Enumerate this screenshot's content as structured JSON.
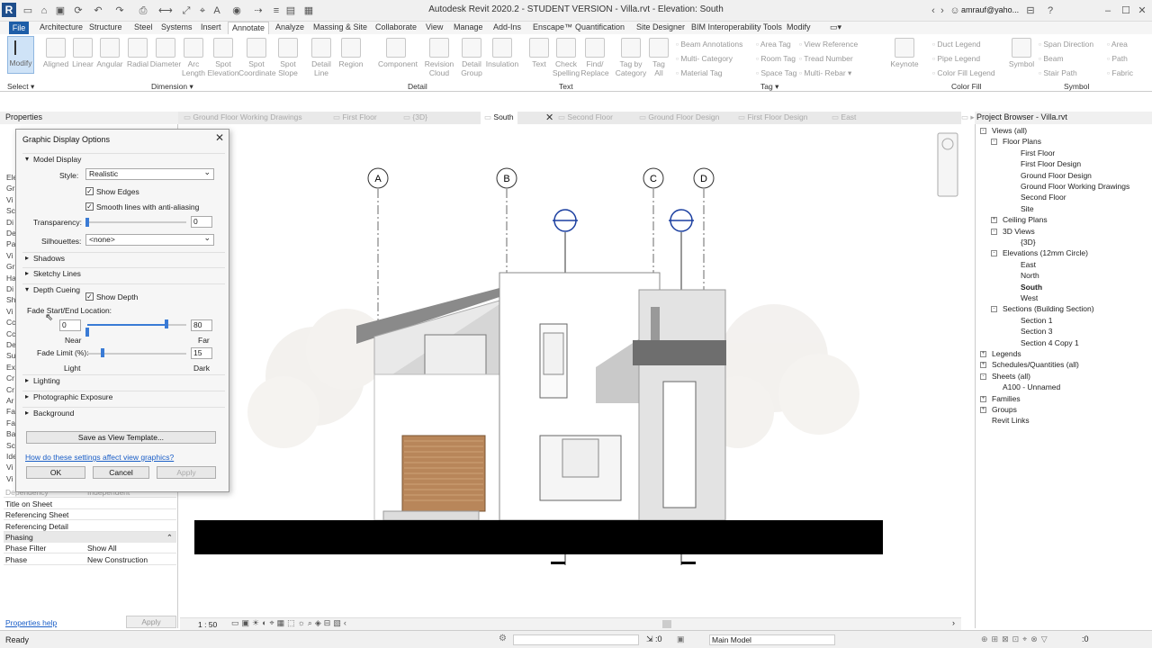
{
  "app": {
    "title": "Autodesk Revit 2020.2 - STUDENT VERSION - Villa.rvt - Elevation: South",
    "user": "amrauf@yaho...",
    "logo": "R"
  },
  "ribbon_tabs": [
    "Architecture",
    "Structure",
    "Steel",
    "Systems",
    "Insert",
    "Annotate",
    "Analyze",
    "Massing & Site",
    "Collaborate",
    "View",
    "Manage",
    "Add-Ins",
    "Enscape™",
    "Quantification",
    "Site Designer",
    "BIM Interoperability Tools",
    "Modify"
  ],
  "file_tab": "File",
  "ribbon": {
    "select": {
      "modify": "Modify",
      "group": "Select ▾"
    },
    "dimension": {
      "tools": [
        "Aligned",
        "Linear",
        "Angular",
        "Radial",
        "Diameter",
        "Arc\nLength",
        "Spot\nElevation",
        "Spot\nCoordinate",
        "Spot\nSlope"
      ],
      "group": "Dimension ▾"
    },
    "detail": {
      "tools": [
        "Detail\nLine",
        "Region",
        "Component",
        "Revision\nCloud",
        "Detail\nGroup",
        "Insulation"
      ],
      "group": "Detail"
    },
    "text": {
      "tools": [
        "Text",
        "Check\nSpelling",
        "Find/\nReplace"
      ],
      "group": "Text"
    },
    "tag": {
      "tools": [
        "Tag by\nCategory",
        "Tag\nAll"
      ],
      "small": [
        "Beam Annotations",
        "Multi- Category",
        "Material Tag",
        "Area Tag",
        "Room Tag",
        "Space Tag",
        "View Reference",
        "Tread Number",
        "Multi- Rebar ▾"
      ],
      "group": "Tag ▾"
    },
    "colorfill": {
      "small": [
        "Duct Legend",
        "Pipe Legend",
        "Color Fill Legend"
      ],
      "keynote": "Keynote",
      "group": "Color Fill"
    },
    "symbol": {
      "tools": [
        "Symbol"
      ],
      "small": [
        "Span Direction",
        "Beam",
        "Stair Path",
        "Area",
        "Path",
        "Fabric"
      ],
      "group": "Symbol"
    }
  },
  "properties": {
    "header": "Properties",
    "rows": [
      {
        "k": "Dependency",
        "v": "Independent"
      },
      {
        "k": "Title on Sheet",
        "v": ""
      },
      {
        "k": "Referencing Sheet",
        "v": ""
      },
      {
        "k": "Referencing Detail",
        "v": ""
      }
    ],
    "phasing_header": "Phasing",
    "phasing_rows": [
      {
        "k": "Phase Filter",
        "v": "Show All"
      },
      {
        "k": "Phase",
        "v": "New Construction"
      }
    ],
    "left_stubs": [
      "Ele",
      "Gra",
      "Vi",
      "Sc",
      "Di",
      "De",
      "Pa",
      "Vi",
      "Gr",
      "Ha",
      "Di",
      "Sh",
      "Vi",
      "Cc",
      "Cc",
      "De",
      "Su",
      "Ext",
      "Cr",
      "Cr",
      "Ar",
      "Fa",
      "Fa",
      "Ba",
      "Sc",
      "Ide",
      "Vi",
      "Vi"
    ],
    "help_link": "Properties help",
    "apply": "Apply"
  },
  "view_tabs": [
    {
      "label": "Ground Floor Working Drawings",
      "active": false
    },
    {
      "label": "First Floor",
      "active": false
    },
    {
      "label": "{3D}",
      "active": false
    },
    {
      "label": "South",
      "active": true
    },
    {
      "label": "Second Floor",
      "active": false
    },
    {
      "label": "Ground Floor Design",
      "active": false
    },
    {
      "label": "First Floor Design",
      "active": false
    },
    {
      "label": "East",
      "active": false
    }
  ],
  "dialog": {
    "title": "Graphic Display Options",
    "model_display": "Model Display",
    "style_label": "Style:",
    "style_value": "Realistic",
    "show_edges": "Show Edges",
    "smooth_lines": "Smooth lines with anti-aliasing",
    "transparency_label": "Transparency:",
    "transparency_value": "0",
    "silhouettes_label": "Silhouettes:",
    "silhouettes_value": "<none>",
    "shadows": "Shadows",
    "sketchy": "Sketchy Lines",
    "depth_cueing": "Depth Cueing",
    "show_depth": "Show Depth",
    "fade_location": "Fade Start/End Location:",
    "near_value": "0",
    "far_value": "80",
    "near": "Near",
    "far": "Far",
    "fade_limit_label": "Fade Limit (%):",
    "fade_limit_value": "15",
    "light": "Light",
    "dark": "Dark",
    "lighting": "Lighting",
    "photographic": "Photographic Exposure",
    "background": "Background",
    "save_template": "Save as View Template...",
    "link": "How do these settings affect view graphics?",
    "ok": "OK",
    "cancel": "Cancel",
    "apply": "Apply",
    "transparency_level": 0,
    "fade_start": 0,
    "fade_end": 80,
    "fade_limit": 15
  },
  "grid_labels": [
    "A",
    "B",
    "C",
    "D"
  ],
  "project_browser": {
    "header": "Project Browser - Villa.rvt",
    "items": [
      {
        "label": "Views (all)",
        "level": 0,
        "exp": "-"
      },
      {
        "label": "Floor Plans",
        "level": 1,
        "exp": "-"
      },
      {
        "label": "First Floor",
        "level": 2
      },
      {
        "label": "First Floor Design",
        "level": 2
      },
      {
        "label": "Ground Floor Design",
        "level": 2
      },
      {
        "label": "Ground Floor Working Drawings",
        "level": 2
      },
      {
        "label": "Second Floor",
        "level": 2
      },
      {
        "label": "Site",
        "level": 2
      },
      {
        "label": "Ceiling Plans",
        "level": 1,
        "exp": "+"
      },
      {
        "label": "3D Views",
        "level": 1,
        "exp": "-"
      },
      {
        "label": "{3D}",
        "level": 2
      },
      {
        "label": "Elevations (12mm Circle)",
        "level": 1,
        "exp": "-"
      },
      {
        "label": "East",
        "level": 2
      },
      {
        "label": "North",
        "level": 2
      },
      {
        "label": "South",
        "level": 2,
        "bold": true
      },
      {
        "label": "West",
        "level": 2
      },
      {
        "label": "Sections (Building Section)",
        "level": 1,
        "exp": "-"
      },
      {
        "label": "Section 1",
        "level": 2
      },
      {
        "label": "Section 3",
        "level": 2
      },
      {
        "label": "Section 4 Copy 1",
        "level": 2
      },
      {
        "label": "Legends",
        "level": 0,
        "exp": "+"
      },
      {
        "label": "Schedules/Quantities (all)",
        "level": 0,
        "exp": "+"
      },
      {
        "label": "Sheets (all)",
        "level": 0,
        "exp": "-"
      },
      {
        "label": "A100 - Unnamed",
        "level": 1
      },
      {
        "label": "Families",
        "level": 0,
        "exp": "+"
      },
      {
        "label": "Groups",
        "level": 0,
        "exp": "+"
      },
      {
        "label": "Revit Links",
        "level": 0
      }
    ]
  },
  "view_control": {
    "scale": "1 : 50"
  },
  "status": {
    "ready": "Ready",
    "count": ":0",
    "model": "Main Model",
    "filter_count": ":0"
  }
}
